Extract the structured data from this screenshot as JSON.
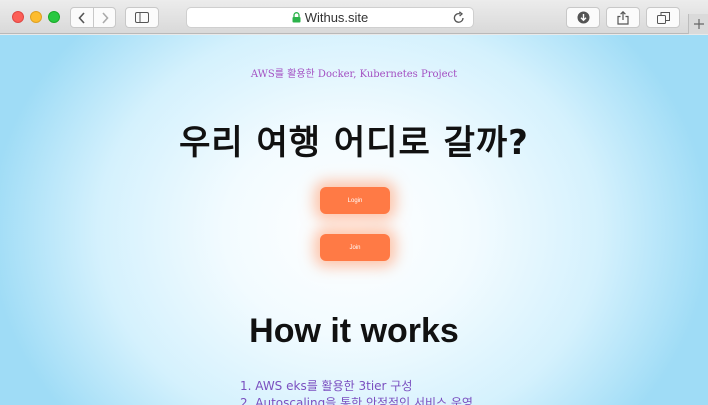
{
  "browser": {
    "url": "Withus.site",
    "new_tab_label": "+"
  },
  "page": {
    "subtitle": "AWS를 활용한 Docker, Kubernetes Project",
    "hero_title": "우리 여행 어디로 갈까?",
    "login_label": "Login",
    "join_label": "Join",
    "how_title": "How it works",
    "features": [
      "1. AWS eks를 활용한 3tier 구성",
      "2. Autoscaling을 통한 안정적인 서비스 운영"
    ]
  }
}
